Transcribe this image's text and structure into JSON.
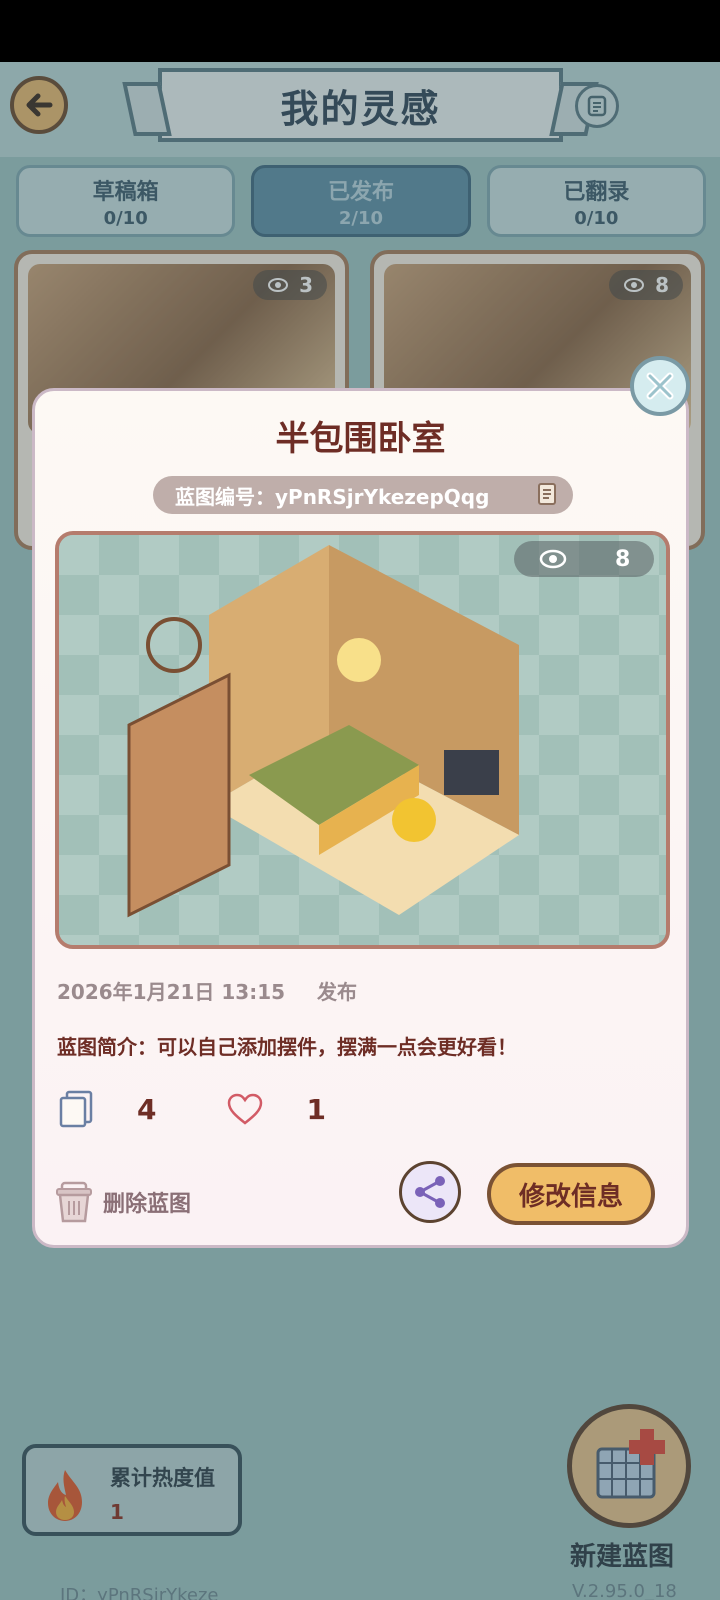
{
  "header": {
    "title": "我的灵感"
  },
  "tabs": [
    {
      "label": "草稿箱",
      "count": "0/10"
    },
    {
      "label": "已发布",
      "count": "2/10"
    },
    {
      "label": "已翻录",
      "count": "0/10"
    }
  ],
  "cards": [
    {
      "views": "3"
    },
    {
      "views": "8"
    }
  ],
  "dialog": {
    "title": "半包围卧室",
    "blueprint_code": "蓝图编号：yPnRSjrYkezepQqg",
    "views": "8",
    "date": "2026年1月21日 13:15",
    "publish_label": "发布",
    "description": "蓝图简介：可以自己添加摆件，摆满一点会更好看！",
    "copies": "4",
    "likes": "1",
    "delete_label": "删除蓝图",
    "edit_label": "修改信息"
  },
  "footer": {
    "heat_label": "累计热度值",
    "heat_value": "1",
    "new_blueprint_label": "新建蓝图",
    "user_id": "ID：yPnRSjrYkeze",
    "version": "V.2.95.0_18"
  },
  "colors": {
    "title_text": "#31475a",
    "dialog_title": "#6e2d25",
    "edit_button": "#f0bd68"
  }
}
